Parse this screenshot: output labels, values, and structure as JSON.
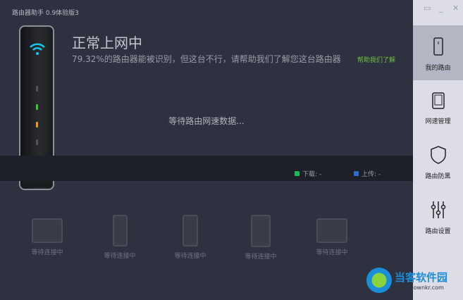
{
  "title": "路由器助手 0.9体验版3",
  "status": "正常上网中",
  "description": "79.32%的路由器能被识别，但这台不行，请帮助我们了解您这台路由器",
  "help_link": "帮助我们了解",
  "waiting": "等待路由网速数据...",
  "legend": {
    "download": "下载: -",
    "upload": "上传: -",
    "download_color": "#1db85c",
    "upload_color": "#2a6fd0"
  },
  "devices": [
    {
      "type": "monitor",
      "label": "等待连接中"
    },
    {
      "type": "phone",
      "label": "等待连接中"
    },
    {
      "type": "phone",
      "label": "等待连接中"
    },
    {
      "type": "tablet",
      "label": "等待连接中"
    },
    {
      "type": "monitor",
      "label": "等待连接中"
    }
  ],
  "sidebar": {
    "items": [
      {
        "label": "我的路由",
        "icon": "router-icon"
      },
      {
        "label": "网速管理",
        "icon": "speed-icon"
      },
      {
        "label": "路由防黑",
        "icon": "shield-icon"
      },
      {
        "label": "路由设置",
        "icon": "sliders-icon"
      }
    ]
  },
  "watermark": {
    "name": "当客软件园",
    "url": "www.downkr.com"
  }
}
